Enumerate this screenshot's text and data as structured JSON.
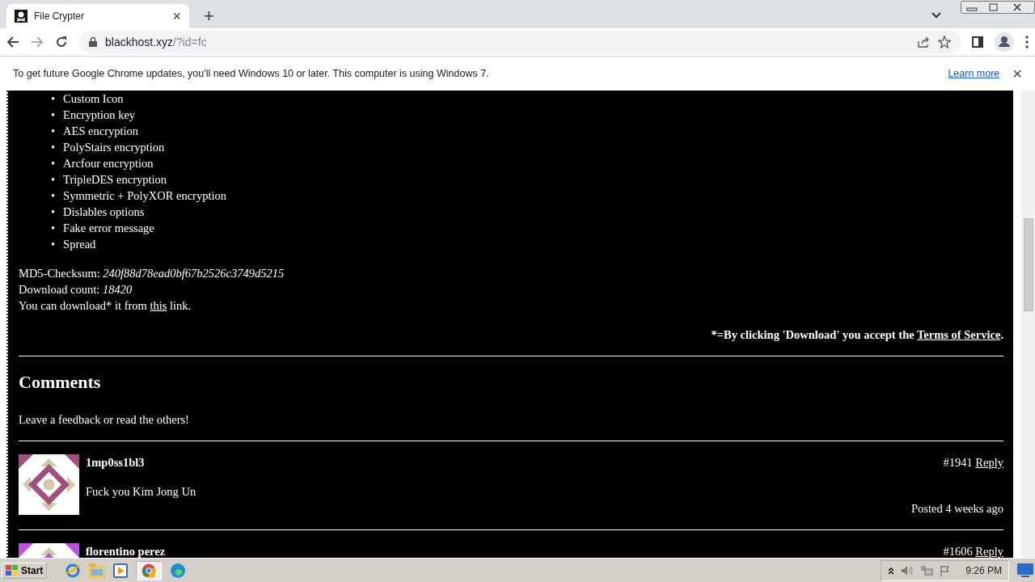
{
  "browser": {
    "tab_title": "File Crypter",
    "close_tab": "×",
    "new_tab": "+",
    "url_host": "blackhost.xyz",
    "url_path": "/?id=fc"
  },
  "infobar": {
    "message": "To get future Google Chrome updates, you'll need Windows 10 or later. This computer is using Windows 7.",
    "link": "Learn more",
    "close": "×"
  },
  "page": {
    "bullet": "•",
    "features": [
      "Custom Icon",
      "Encryption key",
      "AES encryption",
      "PolyStairs encryption",
      "Arcfour encryption",
      "TripleDES encryption",
      "Symmetric + PolyXOR encryption",
      "Dislables options",
      "Fake error message",
      "Spread"
    ],
    "checksum": {
      "label": "MD5-Checksum:",
      "value": "240f88d78ead0bf67b2526c3749d5215"
    },
    "download_count": {
      "label": "Download count:",
      "value": "18420"
    },
    "download_line": {
      "before": "You can download* it from",
      "link": "this",
      "after": "link."
    },
    "notice": {
      "text": "*=By clicking 'Download' you accept the",
      "link": "Terms of Service",
      "end": "."
    },
    "comments_heading": "Comments",
    "comments_intro": "Leave a feedback or read the others!",
    "comments": [
      {
        "author": "1mp0ss1bl3",
        "text": "Fuck you Kim Jong Un",
        "number": "#1941",
        "reply": "Reply",
        "posted": "Posted 4 weeks ago",
        "color": "#a0507a"
      },
      {
        "author": "florentino perez",
        "number": "#1606",
        "reply": "Reply",
        "color": "#c050e0"
      }
    ]
  },
  "taskbar": {
    "start": "Start",
    "clock": "9:26 PM"
  }
}
